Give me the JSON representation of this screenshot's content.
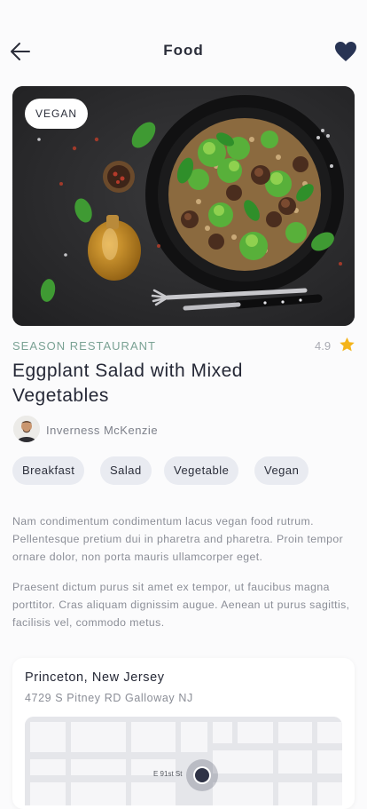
{
  "header": {
    "title": "Food",
    "back_icon": "arrow-left-icon",
    "favorite_icon": "heart-icon",
    "favorite_color": "#283454"
  },
  "hero": {
    "badge": "VEGAN"
  },
  "restaurant": {
    "name": "SEASON RESTAURANT",
    "rating": "4.9",
    "star_color": "#f4b41a",
    "accent_color": "#7aa294"
  },
  "dish": {
    "title": "Eggplant Salad with Mixed Vegetables"
  },
  "author": {
    "name": "Inverness McKenzie"
  },
  "tags": [
    "Breakfast",
    "Salad",
    "Vegetable",
    "Vegan"
  ],
  "description": [
    "Nam condimentum condimentum lacus vegan food rutrum. Pellentesque pretium dui in pharetra and pharetra. Proin tempor ornare dolor, non porta mauris ullamcorper eget.",
    "Praesent dictum purus sit amet ex tempor, ut faucibus magna porttitor. Cras aliquam dignissim augue. Aenean ut purus sagittis, facilisis vel, commodo metus."
  ],
  "location": {
    "city": "Princeton, New Jersey",
    "address": "4729 S Pitney RD Galloway NJ",
    "map_street_label": "E 91st St"
  }
}
